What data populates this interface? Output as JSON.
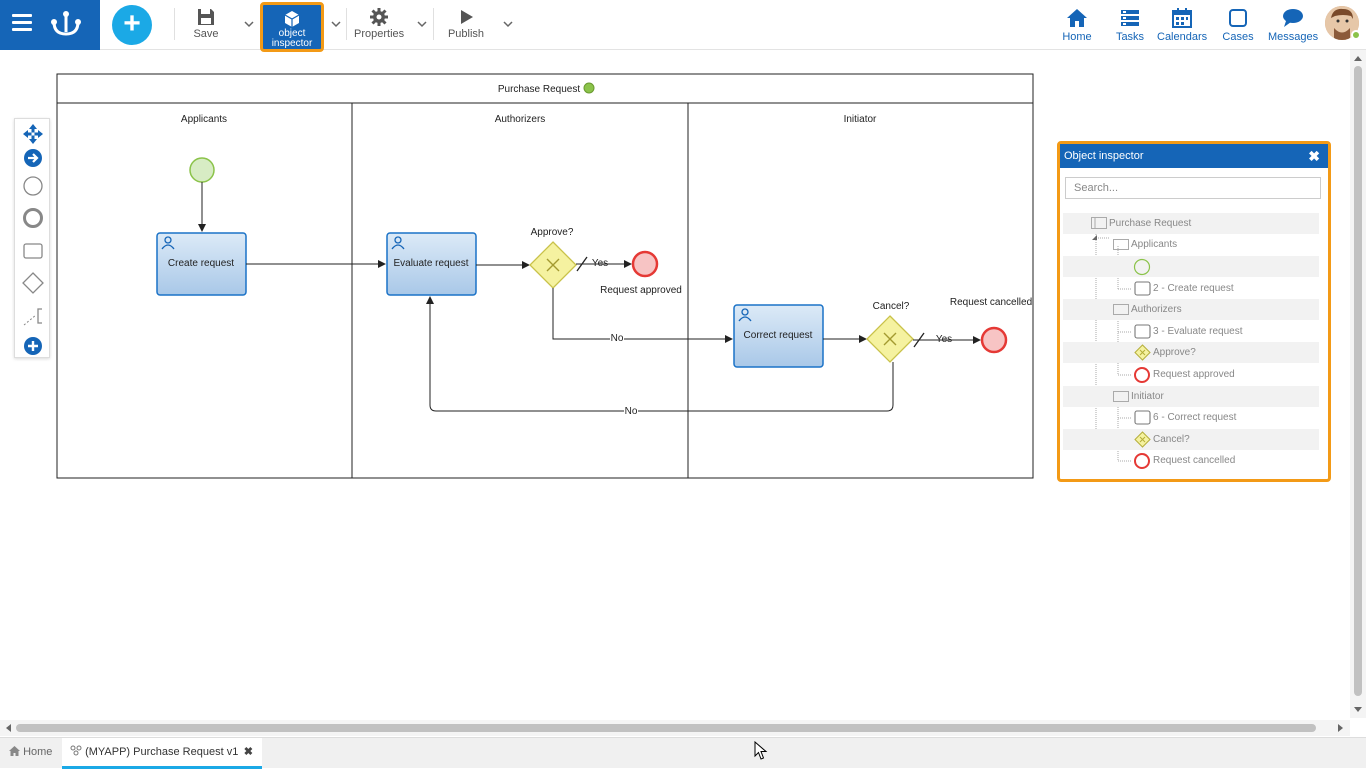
{
  "toolbar": {
    "save_label": "Save",
    "object_inspector_label_1": "object",
    "object_inspector_label_2": "inspector",
    "properties_label": "Properties",
    "publish_label": "Publish"
  },
  "nav": {
    "home": "Home",
    "tasks": "Tasks",
    "calendars": "Calendars",
    "cases": "Cases",
    "messages": "Messages"
  },
  "diagram": {
    "pool_title": "Purchase Request",
    "lanes": [
      "Applicants",
      "Authorizers",
      "Initiator"
    ],
    "tasks": {
      "create": "Create request",
      "evaluate": "Evaluate request",
      "correct": "Correct request"
    },
    "gateways": {
      "approve": "Approve?",
      "cancel": "Cancel?"
    },
    "events": {
      "approved": "Request approved",
      "cancelled": "Request cancelled"
    },
    "flows": {
      "yes1": "Yes",
      "no1": "No",
      "yes2": "Yes",
      "no2": "No"
    }
  },
  "object_inspector": {
    "title": "Object inspector",
    "search_placeholder": "Search...",
    "tree": [
      {
        "label": "Purchase Request",
        "icon": "pool-icon"
      },
      {
        "label": "Applicants",
        "icon": "lane-icon"
      },
      {
        "label": "",
        "icon": "start-event-icon"
      },
      {
        "label": "2 - Create request",
        "icon": "task-icon"
      },
      {
        "label": "Authorizers",
        "icon": "lane-icon"
      },
      {
        "label": "3 - Evaluate request",
        "icon": "task-icon"
      },
      {
        "label": "Approve?",
        "icon": "gateway-icon"
      },
      {
        "label": "Request approved",
        "icon": "end-event-icon"
      },
      {
        "label": "Initiator",
        "icon": "lane-icon"
      },
      {
        "label": "6 - Correct request",
        "icon": "task-icon"
      },
      {
        "label": "Cancel?",
        "icon": "gateway-icon"
      },
      {
        "label": "Request cancelled",
        "icon": "end-event-icon"
      }
    ]
  },
  "tabs": {
    "home": "Home",
    "process": "(MYAPP) Purchase Request v1"
  },
  "colors": {
    "brand": "#1565b7",
    "accent": "#1ba9e6",
    "highlight": "#f39a16",
    "start_event": "#8bc34a",
    "end_event": "#e53935",
    "gateway": "#e8e35a"
  }
}
